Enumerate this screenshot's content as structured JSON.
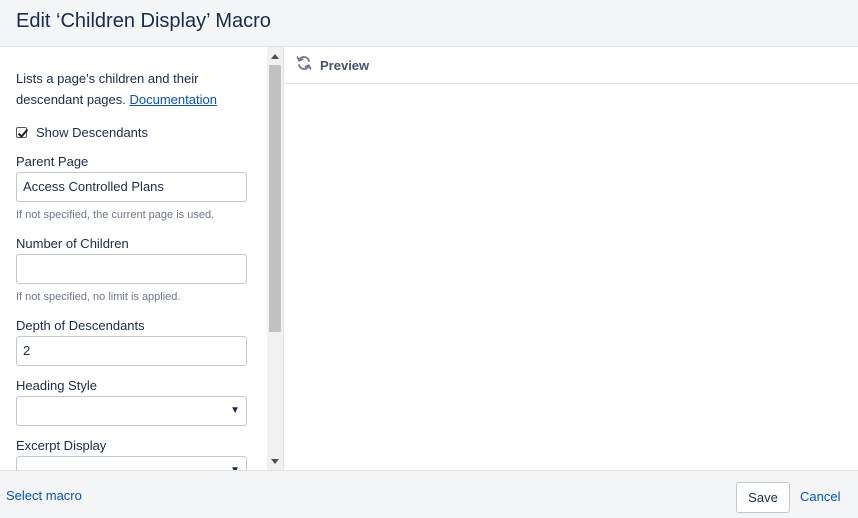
{
  "dialog": {
    "title": "Edit ‘Children Display’ Macro"
  },
  "form": {
    "description": "Lists a page's children and their descendant pages.",
    "documentation_link": "Documentation",
    "show_descendants": {
      "label": "Show Descendants",
      "checked": true
    },
    "parent_page": {
      "label": "Parent Page",
      "value": "Access Controlled Plans",
      "hint": "If not specified, the current page is used."
    },
    "number_of_children": {
      "label": "Number of Children",
      "value": "",
      "hint": "If not specified, no limit is applied."
    },
    "depth_of_descendants": {
      "label": "Depth of Descendants",
      "value": "2"
    },
    "heading_style": {
      "label": "Heading Style",
      "value": ""
    },
    "excerpt_display": {
      "label": "Excerpt Display",
      "value": ""
    }
  },
  "preview": {
    "label": "Preview",
    "icon": "refresh-icon"
  },
  "footer": {
    "select_macro": "Select macro",
    "save": "Save",
    "cancel": "Cancel"
  },
  "colors": {
    "link": "#0052cc",
    "header_bg": "#f4f5f7",
    "border": "#dfe1e6",
    "text": "#172b4d",
    "hint": "#6b778c"
  }
}
